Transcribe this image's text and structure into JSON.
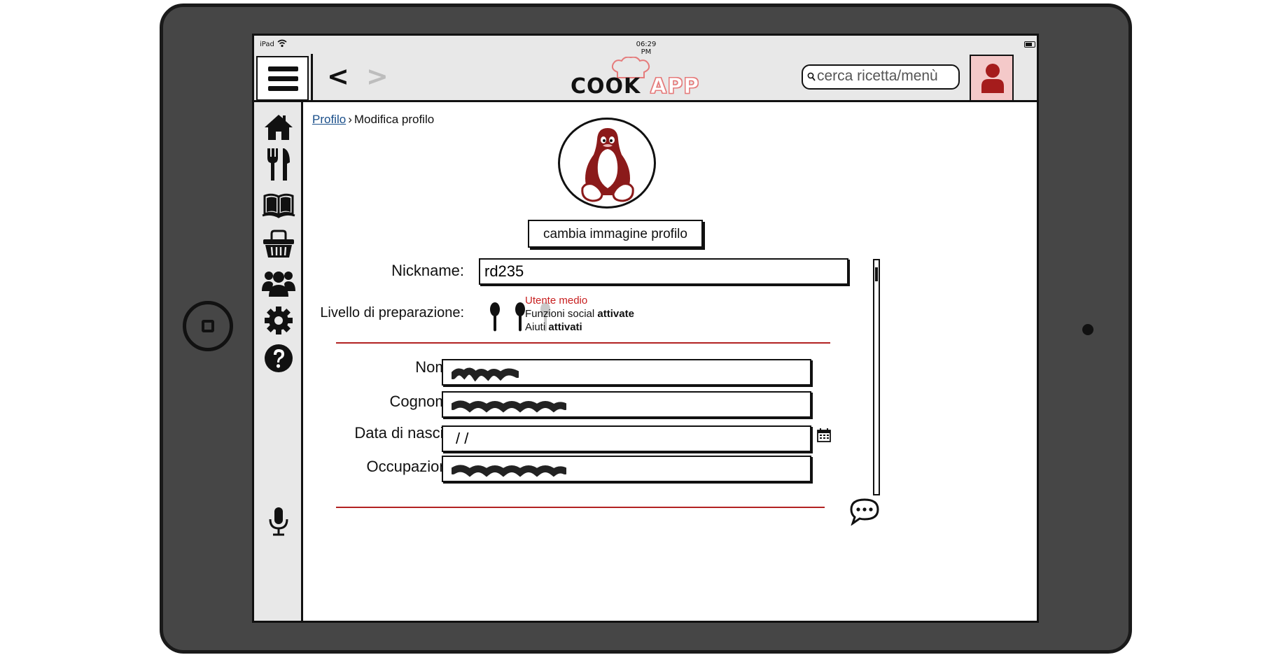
{
  "status_bar": {
    "device": "iPad",
    "time": "06:29 PM"
  },
  "header": {
    "back_label": "<",
    "forward_label": ">",
    "logo_cook": "COOK",
    "logo_app": "APP",
    "search_placeholder": "cerca ricetta/menù"
  },
  "sidebar": {
    "items": [
      {
        "icon": "home-icon"
      },
      {
        "icon": "cutlery-icon"
      },
      {
        "icon": "book-icon"
      },
      {
        "icon": "basket-icon"
      },
      {
        "icon": "users-icon"
      },
      {
        "icon": "gear-icon"
      },
      {
        "icon": "help-icon"
      }
    ],
    "mic_icon": "microphone-icon"
  },
  "breadcrumb": {
    "parent": "Profilo",
    "separator": "›",
    "current": "Modifica profilo"
  },
  "profile": {
    "change_photo_label": "cambia immagine profilo",
    "nickname_label": "Nickname:",
    "nickname_value": "rd235",
    "level_label": "Livello di preparazione:",
    "level_filled": 2,
    "level_total": 3,
    "level_name": "Utente medio",
    "social_prefix": "Funzioni social",
    "social_state": "attivate",
    "help_prefix": "Aiuti",
    "help_state": "attivati"
  },
  "personal": {
    "nome_label": "Nome:",
    "cognome_label": "Cognome:",
    "data_label": "Data di nascita:",
    "data_value": "/ /",
    "occupazione_label": "Occupazione:"
  },
  "colors": {
    "accent_red": "#b22222",
    "user_box_bg": "#f4c9c9",
    "link_blue": "#1a4f8a"
  }
}
